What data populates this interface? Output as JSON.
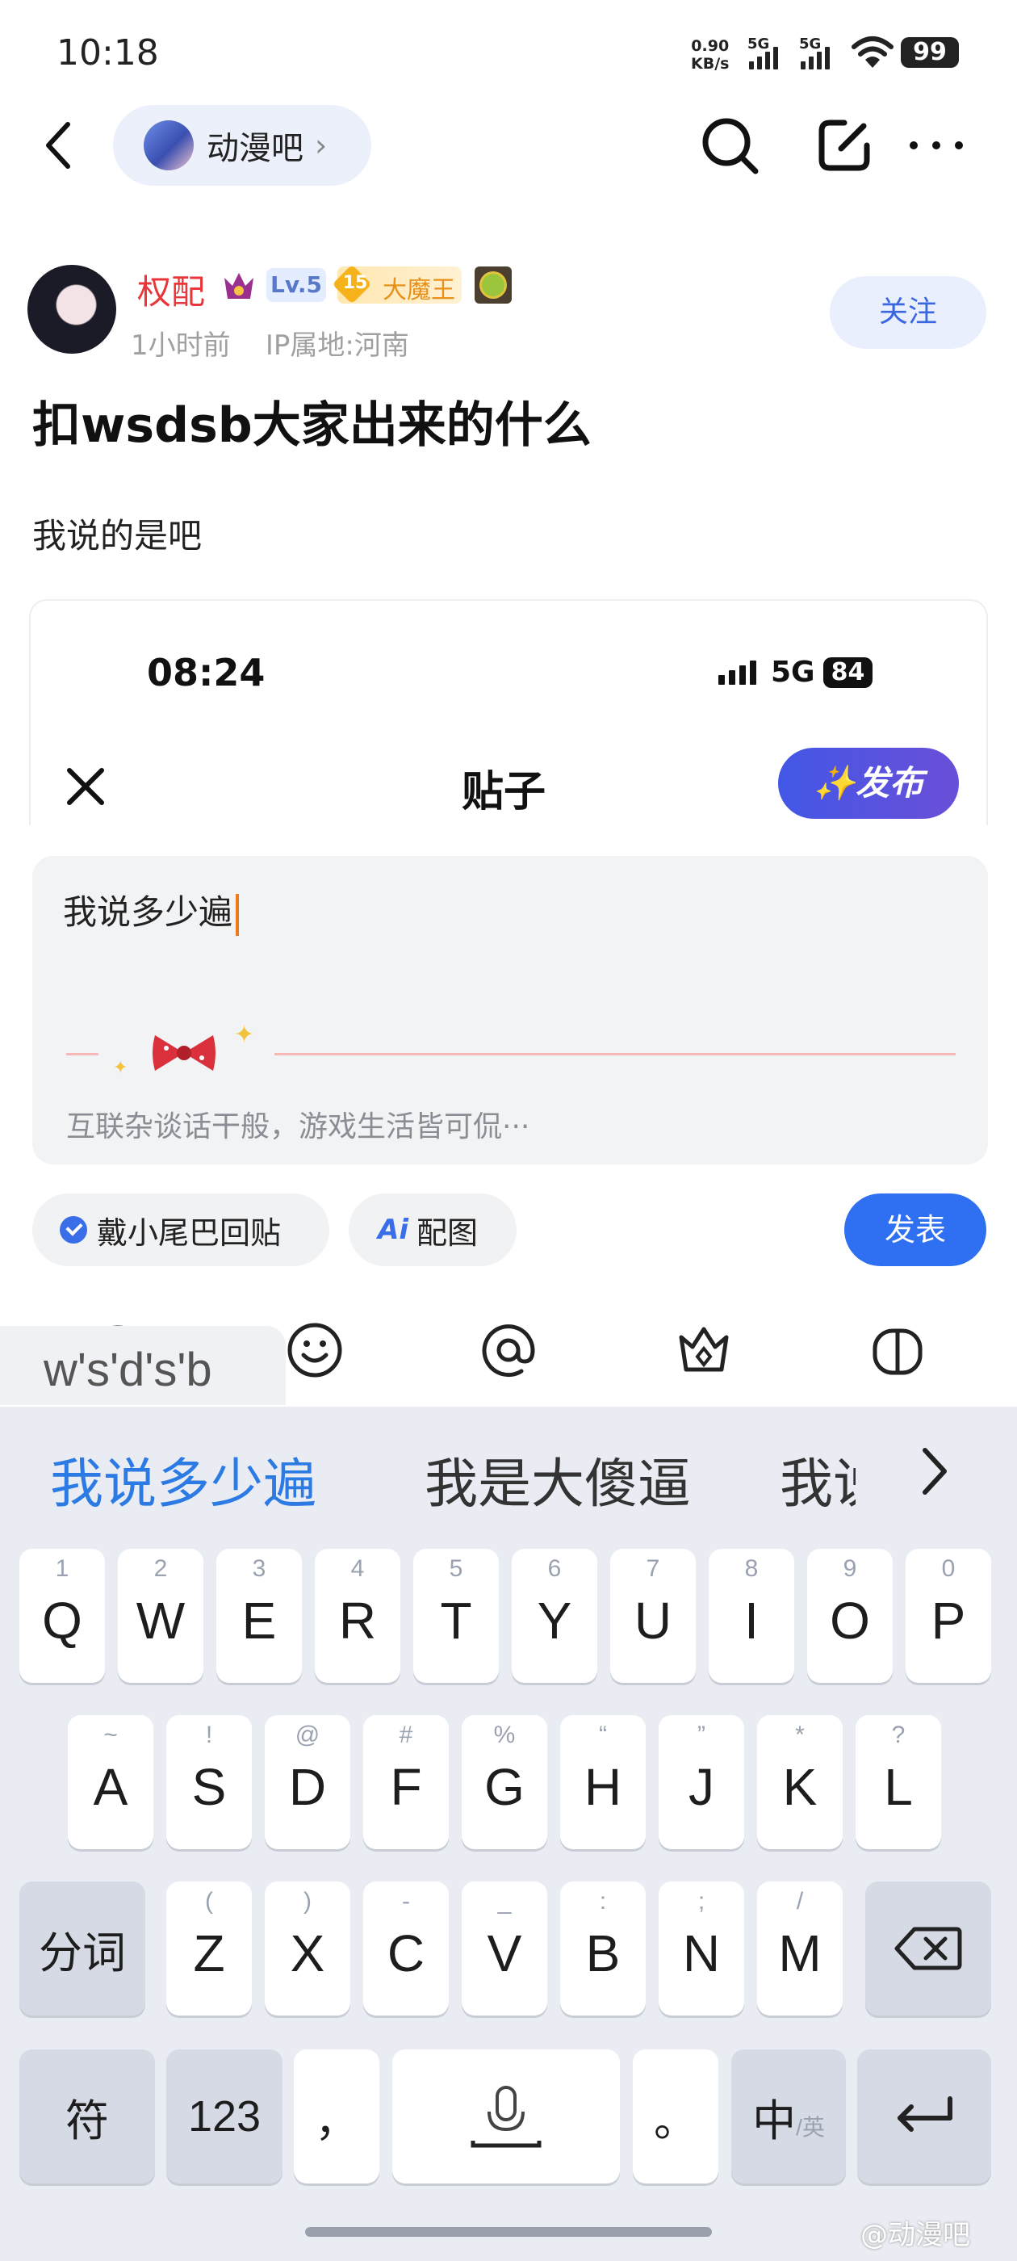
{
  "status_bar": {
    "time": "10:18",
    "net_speed_value": "0.90",
    "net_speed_unit": "KB/s",
    "sim1": "5G",
    "sim2": "5G",
    "battery": "99"
  },
  "nav": {
    "forum_name": "动漫吧",
    "icons": [
      "back-icon",
      "forum-avatar",
      "chevron-right-icon",
      "search-icon",
      "edit-icon",
      "more-icon"
    ]
  },
  "post": {
    "author_name": "权配",
    "level": "Lv.5",
    "title_level": "15",
    "title_badge": "大魔王",
    "time": "1小时前",
    "ip_location": "IP属地:河南",
    "follow_label": "关注",
    "title": "扣wsdsb大家出来的什么",
    "body": "我说的是吧"
  },
  "embedded_screenshot": {
    "time": "08:24",
    "network": "5G",
    "battery": "84",
    "heading": "贴子",
    "publish_label": "✨发布"
  },
  "reply": {
    "text": "我说多少遍",
    "hint": "互联杂谈话干般，游戏生活皆可侃···",
    "tail_chip": "戴小尾巴回贴",
    "picture_chip": "配图",
    "picture_chip_icon": "Ai",
    "send_label": "发表"
  },
  "toolbar": {
    "icons": [
      "ghost-icon",
      "emoji-icon",
      "at-icon",
      "crown-icon",
      "gift-icon"
    ]
  },
  "ime": {
    "pinyin": "w's'd's'b",
    "candidates": [
      "我说多少遍",
      "我是大傻逼",
      "我说"
    ],
    "row1": [
      {
        "sub": "1",
        "key": "Q"
      },
      {
        "sub": "2",
        "key": "W"
      },
      {
        "sub": "3",
        "key": "E"
      },
      {
        "sub": "4",
        "key": "R"
      },
      {
        "sub": "5",
        "key": "T"
      },
      {
        "sub": "6",
        "key": "Y"
      },
      {
        "sub": "7",
        "key": "U"
      },
      {
        "sub": "8",
        "key": "I"
      },
      {
        "sub": "9",
        "key": "O"
      },
      {
        "sub": "0",
        "key": "P"
      }
    ],
    "row2": [
      {
        "sub": "~",
        "key": "A"
      },
      {
        "sub": "!",
        "key": "S"
      },
      {
        "sub": "@",
        "key": "D"
      },
      {
        "sub": "#",
        "key": "F"
      },
      {
        "sub": "%",
        "key": "G"
      },
      {
        "sub": "“",
        "key": "H"
      },
      {
        "sub": "”",
        "key": "J"
      },
      {
        "sub": "*",
        "key": "K"
      },
      {
        "sub": "?",
        "key": "L"
      }
    ],
    "row3": [
      {
        "sub": "(",
        "key": "Z"
      },
      {
        "sub": ")",
        "key": "X"
      },
      {
        "sub": "-",
        "key": "C"
      },
      {
        "sub": "_",
        "key": "V"
      },
      {
        "sub": ":",
        "key": "B"
      },
      {
        "sub": ";",
        "key": "N"
      },
      {
        "sub": "/",
        "key": "M"
      }
    ],
    "segment_key": "分词",
    "symbol_key": "符",
    "number_key": "123",
    "comma_key": "，",
    "period_key": "。",
    "lang_key": "中",
    "lang_key_sub": "/英"
  },
  "watermark": "@动漫吧"
}
